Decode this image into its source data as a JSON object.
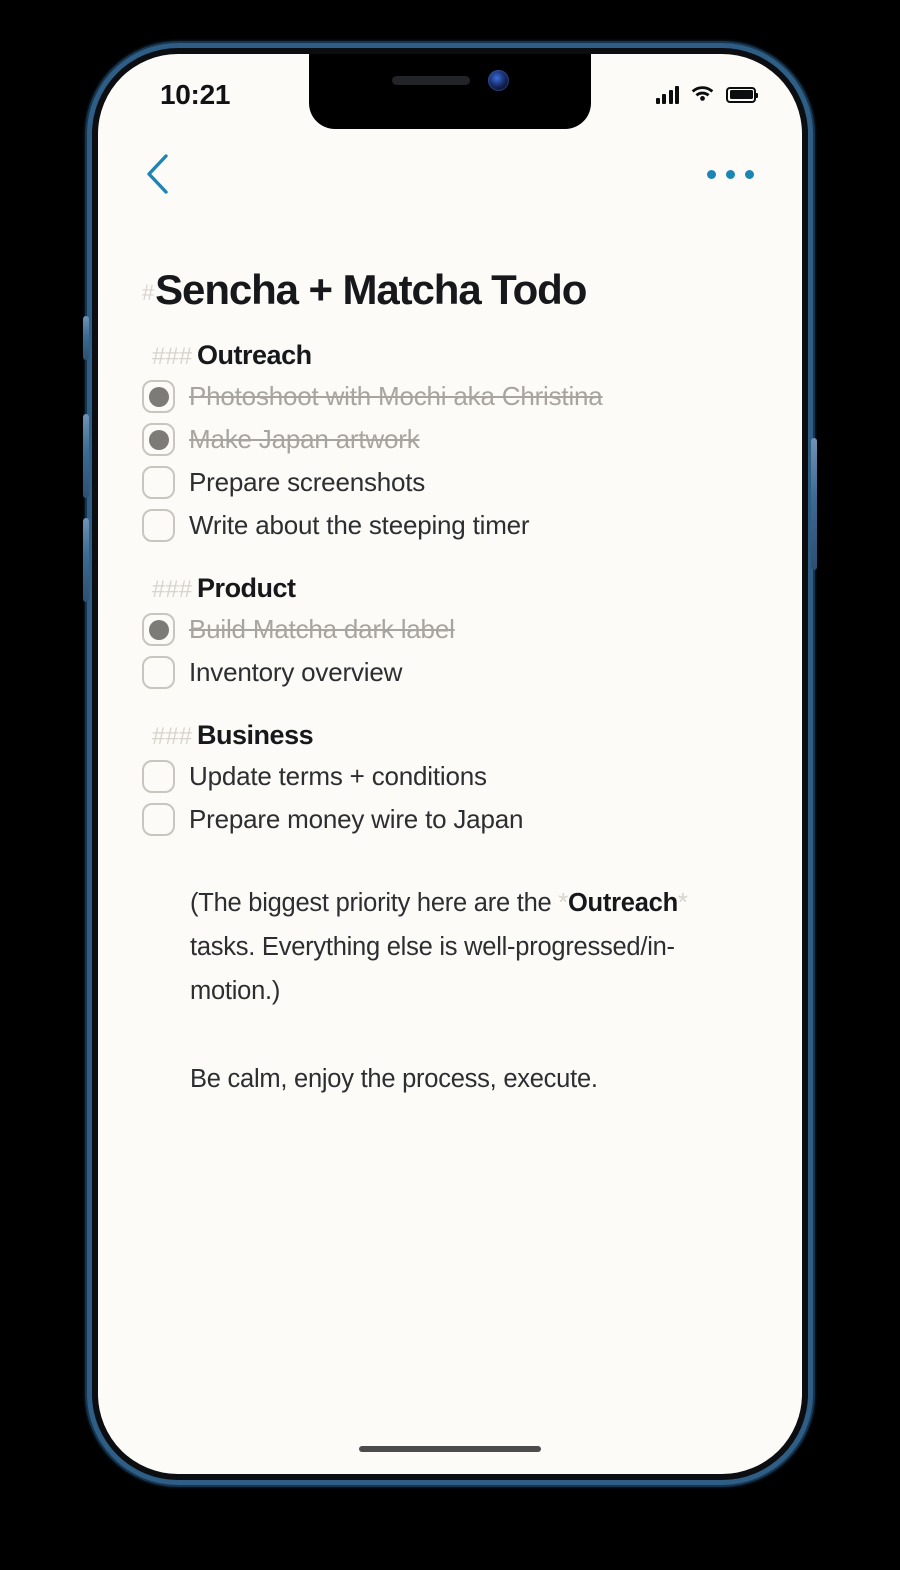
{
  "status_bar": {
    "time": "10:21",
    "signal_icon": "cellular-signal-icon",
    "wifi_icon": "wifi-icon",
    "battery_icon": "battery-full-icon"
  },
  "nav": {
    "back_icon": "back-chevron-icon",
    "more_icon": "more-options-icon",
    "accent_color": "#1d85b4"
  },
  "document": {
    "title": "Sencha + Matcha Todo",
    "title_mark": "#",
    "heading_mark": "###",
    "sections": [
      {
        "heading": "Outreach",
        "items": [
          {
            "label": "Photoshoot with Mochi aka Christina",
            "done": true
          },
          {
            "label": "Make Japan artwork",
            "done": true
          },
          {
            "label": "Prepare screenshots",
            "done": false
          },
          {
            "label": "Write about the steeping timer",
            "done": false
          }
        ]
      },
      {
        "heading": "Product",
        "items": [
          {
            "label": "Build Matcha dark label",
            "done": true
          },
          {
            "label": "Inventory overview",
            "done": false
          }
        ]
      },
      {
        "heading": "Business",
        "items": [
          {
            "label": "Update terms + conditions",
            "done": false
          },
          {
            "label": "Prepare money wire to Japan",
            "done": false
          }
        ]
      }
    ],
    "paragraphs": [
      {
        "parts": [
          {
            "text": "(The biggest priority here are the ",
            "style": "normal"
          },
          {
            "text": "*",
            "style": "mark"
          },
          {
            "text": "Outreach",
            "style": "bold"
          },
          {
            "text": "*",
            "style": "mark"
          },
          {
            "text": " tasks. Everything else is well-progressed/in-motion.)",
            "style": "normal"
          }
        ]
      },
      {
        "parts": [
          {
            "text": "Be calm, enjoy the process, execute.",
            "style": "normal"
          }
        ]
      }
    ]
  },
  "colors": {
    "screen_background": "#fdfbf7",
    "text_primary": "#2c2e31",
    "text_done": "#a8a5a0",
    "markdown_mark": "#d7d3cd",
    "checkbox_border": "#c9c6c0",
    "checkbox_dot": "#7d7b78",
    "frame": "#2e5d85"
  }
}
